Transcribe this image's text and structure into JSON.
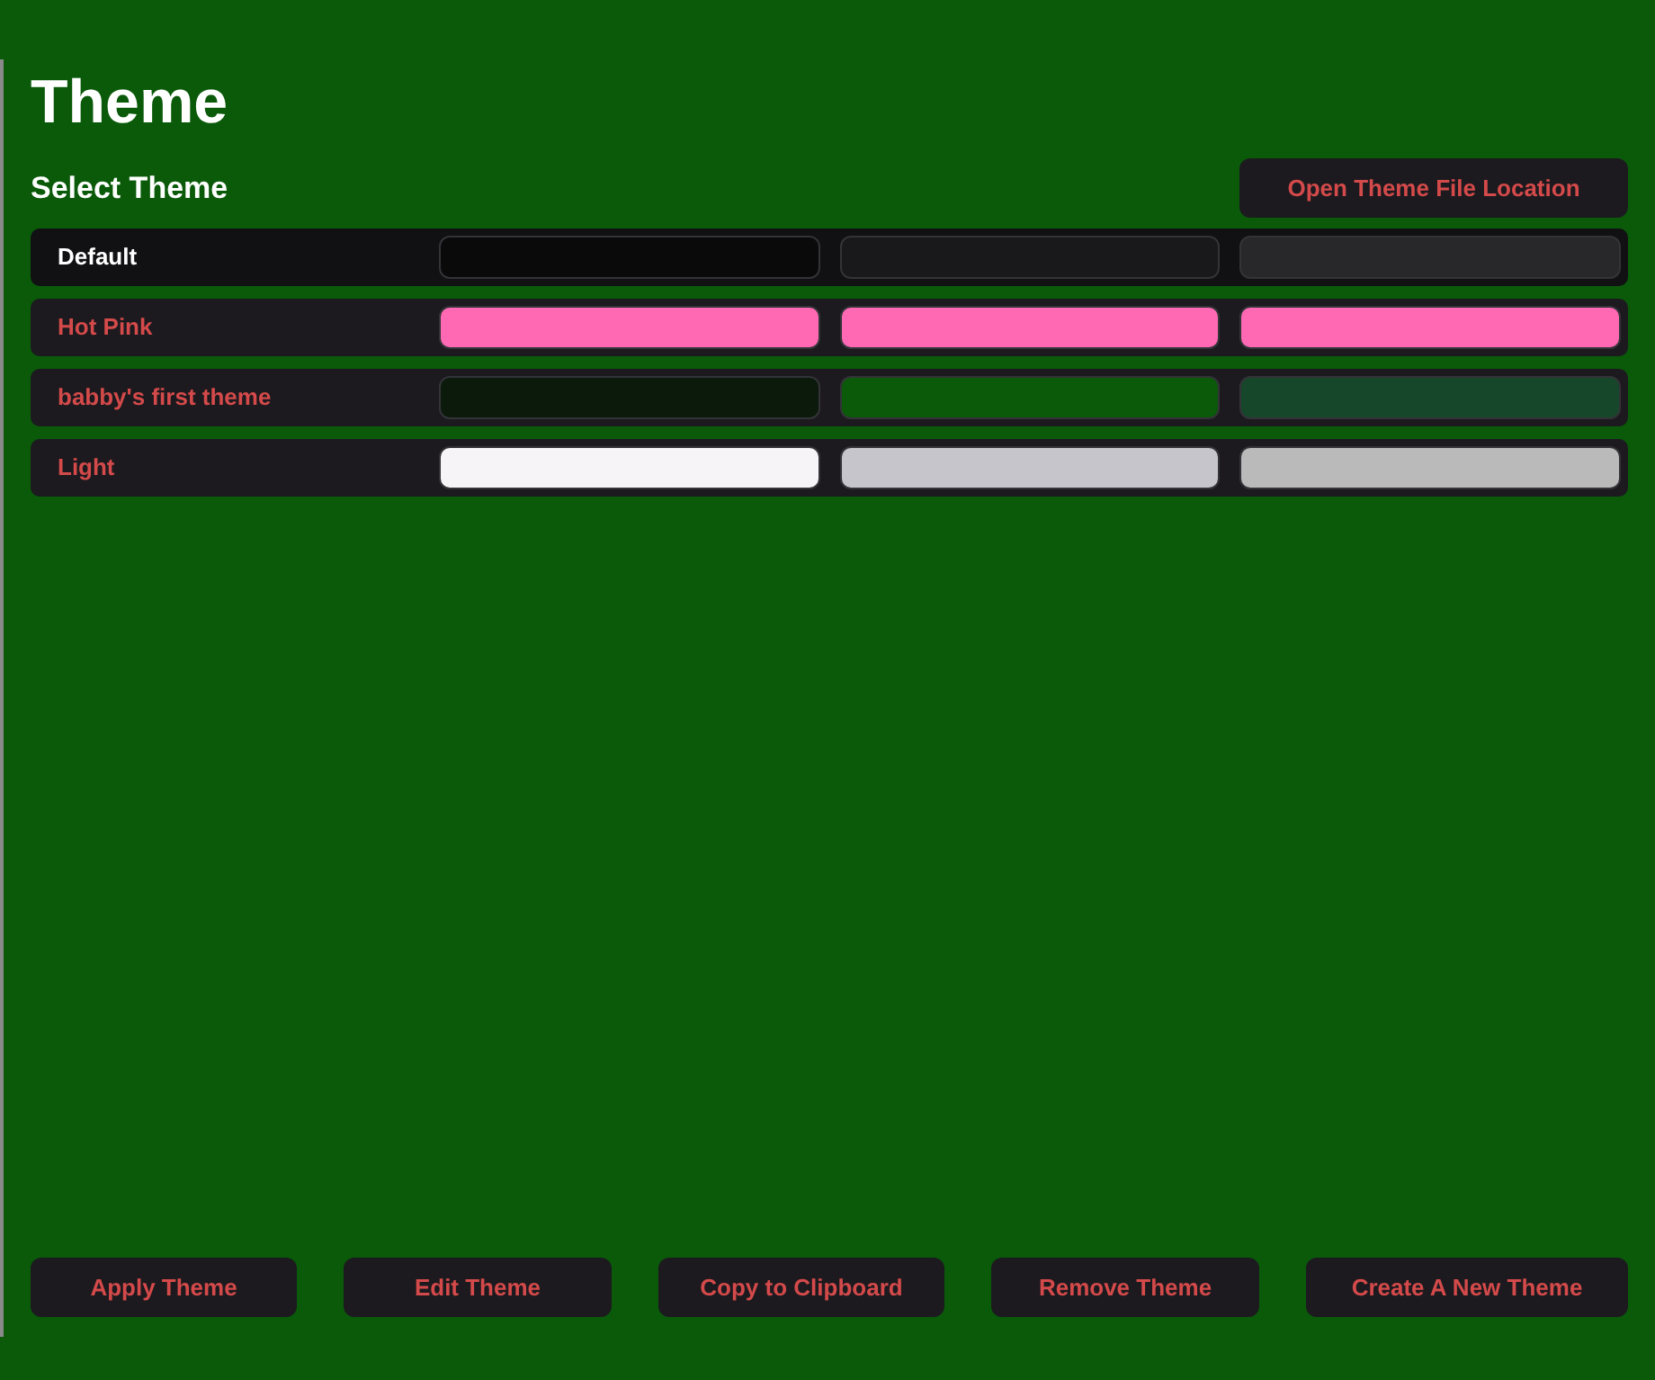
{
  "title": "Theme",
  "section_title": "Select Theme",
  "open_location_button": "Open Theme File Location",
  "themes": [
    {
      "name": "Default",
      "selected": true,
      "swatches": [
        {
          "color": "#0a0a0b"
        },
        {
          "color": "#19191c"
        },
        {
          "color": "#28282b"
        }
      ]
    },
    {
      "name": "Hot Pink",
      "selected": false,
      "swatches": [
        {
          "color": "#ff69b4"
        },
        {
          "color": "#ff69b4"
        },
        {
          "color": "#ff69b4"
        }
      ]
    },
    {
      "name": "babby's first theme",
      "selected": false,
      "swatches": [
        {
          "color": "#0b1a0b"
        },
        {
          "color": "#0a5a0a"
        },
        {
          "color": "#17472a"
        }
      ]
    },
    {
      "name": "Light",
      "selected": false,
      "swatches": [
        {
          "color": "#f6f4f6"
        },
        {
          "color": "#c6c5cb"
        },
        {
          "color": "#bababa"
        }
      ]
    }
  ],
  "buttons": [
    "Apply Theme",
    "Edit Theme",
    "Copy to Clipboard",
    "Remove Theme",
    "Create A New Theme"
  ]
}
